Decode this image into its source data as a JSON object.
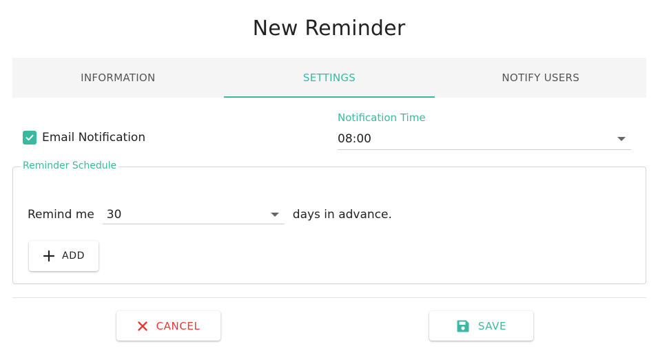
{
  "dialog": {
    "title": "New Reminder"
  },
  "tabs": [
    {
      "label": "INFORMATION",
      "active": false
    },
    {
      "label": "SETTINGS",
      "active": true
    },
    {
      "label": "NOTIFY USERS",
      "active": false
    }
  ],
  "settings": {
    "email_notification": {
      "label": "Email Notification",
      "checked": true
    },
    "notification_time": {
      "label": "Notification Time",
      "value": "08:00"
    },
    "schedule": {
      "legend": "Reminder Schedule",
      "remind_label": "Remind me",
      "days_value": "30",
      "suffix": "days in advance.",
      "add_label": "ADD"
    }
  },
  "footer": {
    "cancel_label": "CANCEL",
    "save_label": "SAVE"
  },
  "colors": {
    "accent": "#3bb8a0",
    "danger": "#e53935",
    "tab_bg": "#f5f5f5"
  },
  "icons": [
    "check-icon",
    "chevron-down-icon",
    "plus-icon",
    "close-icon",
    "save-icon"
  ]
}
